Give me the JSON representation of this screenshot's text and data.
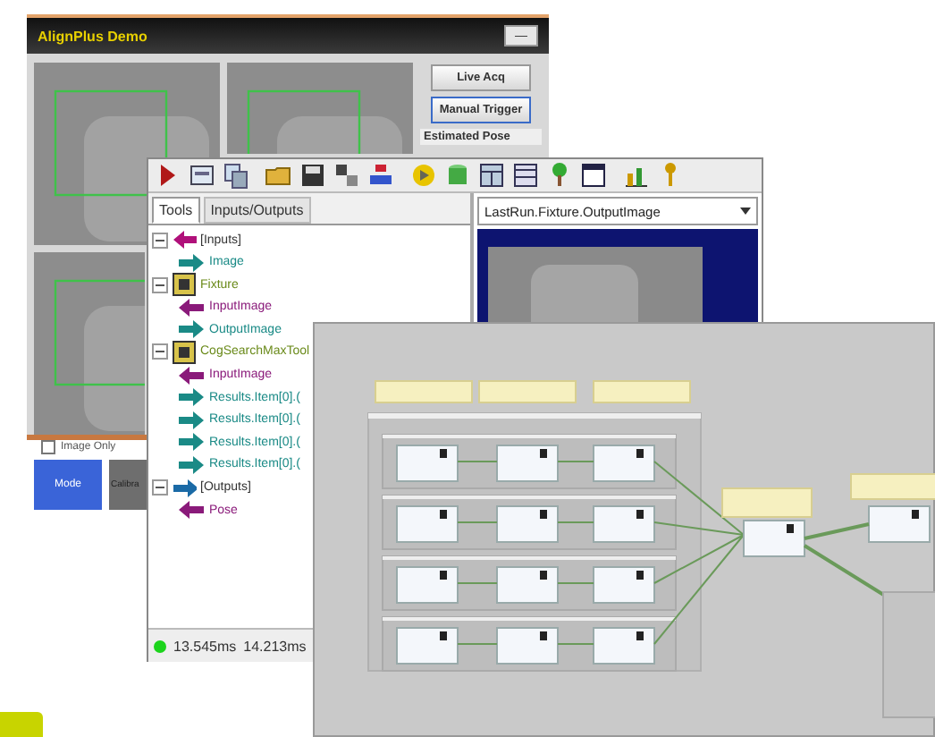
{
  "demo_window": {
    "title": "AlignPlus Demo",
    "close_label": "—",
    "buttons": [
      "Live Acq",
      "Manual Trigger"
    ],
    "pose_label": "Estimated Pose",
    "checkbox": {
      "label": "Image Only",
      "checked": false
    },
    "mode_buttons": [
      {
        "label": "Mode",
        "selected": true
      },
      {
        "label": "Calibra",
        "selected": false
      }
    ]
  },
  "tool_window": {
    "tabs": [
      {
        "label": "Tools",
        "selected": true
      },
      {
        "label": "Inputs/Outputs",
        "selected": false
      }
    ],
    "image_selector": "LastRun.Fixture.OutputImage",
    "tree": [
      {
        "label": "[Inputs]",
        "kind": "group",
        "expanded": true,
        "children": [
          {
            "label": "Image",
            "kind": "out"
          }
        ]
      },
      {
        "label": "Fixture",
        "kind": "tool",
        "expanded": true,
        "children": [
          {
            "label": "InputImage",
            "kind": "in"
          },
          {
            "label": "OutputImage",
            "kind": "out"
          }
        ]
      },
      {
        "label": "CogSearchMaxTool",
        "kind": "tool",
        "expanded": true,
        "children": [
          {
            "label": "InputImage",
            "kind": "in"
          },
          {
            "label": "Results.Item[0].(",
            "kind": "out"
          },
          {
            "label": "Results.Item[0].(",
            "kind": "out"
          },
          {
            "label": "Results.Item[0].(",
            "kind": "out"
          },
          {
            "label": "Results.Item[0].(",
            "kind": "out"
          }
        ]
      },
      {
        "label": "[Outputs]",
        "kind": "group",
        "expanded": true,
        "children": [
          {
            "label": "Pose",
            "kind": "in"
          }
        ]
      }
    ],
    "status": {
      "ok": true,
      "times": [
        "13.545ms",
        "14.213ms"
      ]
    }
  }
}
